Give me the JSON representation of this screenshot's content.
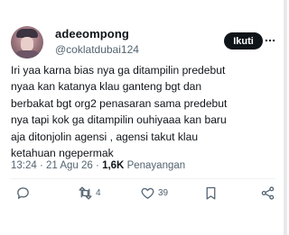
{
  "author": {
    "display_name": "adeeompong",
    "handle": "@coklatdubai124",
    "follow_label": "Ikuti"
  },
  "tweet": {
    "text": "Iri yaa karna bias nya ga ditampilin predebut\nnyaa kan katanya klau ganteng bgt dan\nberbakat bgt org2 penasaran sama predebut\nnya tapi kok ga ditampilin ouhiyaaa kan baru\naja ditonjolin agensi , agensi takut klau\nketahuan ngepermak",
    "time": "13:24",
    "date": "21 Agu 26",
    "views_count": "1,6K",
    "views_label": "Penayangan"
  },
  "actions": {
    "reply": {
      "icon": "reply-icon",
      "count": ""
    },
    "retweet": {
      "icon": "retweet-icon",
      "count": "4"
    },
    "like": {
      "icon": "heart-icon",
      "count": "39"
    },
    "bookmark": {
      "icon": "bookmark-icon",
      "count": ""
    },
    "share": {
      "icon": "share-icon",
      "count": ""
    }
  },
  "colors": {
    "text": "#0f1419",
    "secondary": "#536471",
    "follow_bg": "#0f1419",
    "follow_text": "#ffffff"
  }
}
